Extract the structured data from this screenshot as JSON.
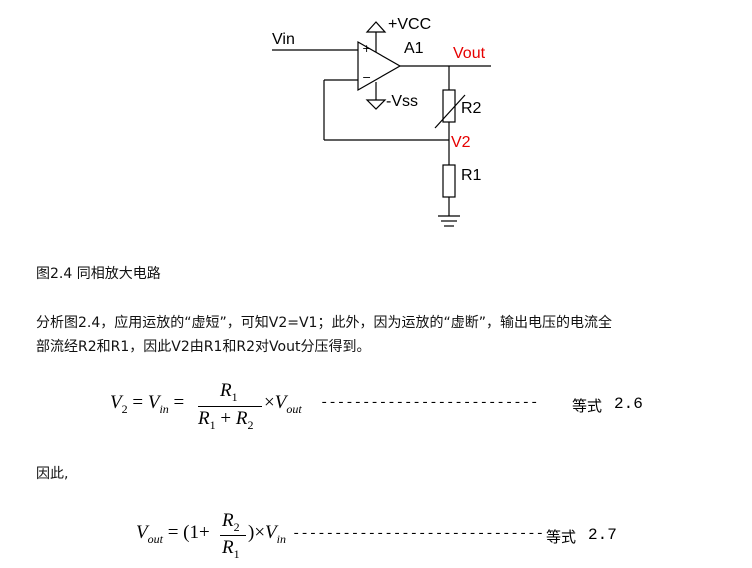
{
  "circuit": {
    "vin": "Vin",
    "vcc": "+VCC",
    "vss": "-Vss",
    "amp": "A1",
    "vout": "Vout",
    "r2": "R2",
    "v2": "V2",
    "r1": "R1",
    "plus": "+",
    "minus": "−"
  },
  "caption": "图2.4 同相放大电路",
  "paragraph": {
    "line1": "分析图2.4，应用运放的“虚短”，可知V2=V1；此外，因为运放的“虚断”，输出电压的电流全",
    "line2": "部流经R2和R1，因此V2由R1和R2对Vout分压得到。"
  },
  "eq26": {
    "V": "V",
    "sub2": "2",
    "eq1": "=",
    "Vin": "V",
    "sub_in": "in",
    "eq2": "=",
    "num": "R",
    "num_sub": "1",
    "den_a": "R",
    "den_a_sub": "1",
    "plus": "+",
    "den_b": "R",
    "den_b_sub": "2",
    "times": "×",
    "Vout": "V",
    "sub_out": "out",
    "dashes": "--------------------------",
    "label": "等式",
    "number": "2.6"
  },
  "therefore": "因此,",
  "eq27": {
    "V": "V",
    "sub_out": "out",
    "eq": "=",
    "open": "(1+",
    "num": "R",
    "num_sub": "2",
    "den": "R",
    "den_sub": "1",
    "close": ")×",
    "Vin": "V",
    "sub_in": "in",
    "dashes": "------------------------------",
    "label": "等式",
    "number": "2.7"
  },
  "colors": {
    "accent_red": "#e60000",
    "line": "#000000"
  }
}
